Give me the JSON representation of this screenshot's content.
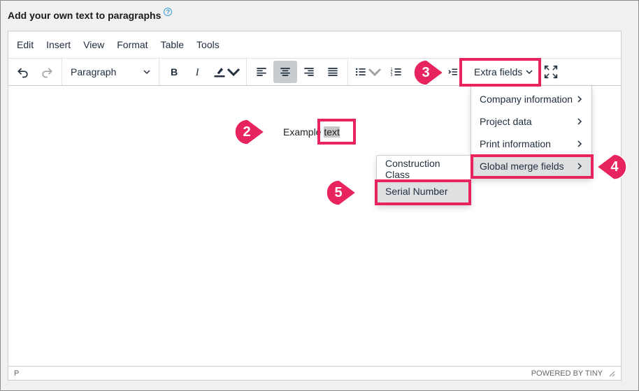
{
  "heading": "Add your own text to paragraphs",
  "menubar": [
    "Edit",
    "Insert",
    "View",
    "Format",
    "Table",
    "Tools"
  ],
  "toolbar": {
    "block_format": "Paragraph",
    "extra_fields": "Extra fields"
  },
  "content": {
    "text_before": "Example ",
    "text_selected": "text"
  },
  "extra_menu": [
    "Company information",
    "Project data",
    "Print information",
    "Global merge fields"
  ],
  "submenu": [
    "Construction Class",
    "Serial Number"
  ],
  "statusbar": {
    "path": "P",
    "brand": "POWERED BY TINY"
  },
  "callouts": [
    "2",
    "3",
    "4",
    "5"
  ],
  "colors": {
    "accent": "#e8245e",
    "selection": "#c8c8c8"
  }
}
